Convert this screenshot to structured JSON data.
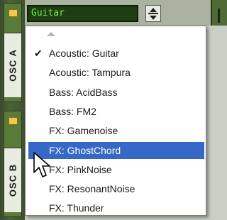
{
  "osc_panel": {
    "label_a": "OSC A",
    "label_b": "OSC B"
  },
  "patch_selector": {
    "current_value": "Guitar"
  },
  "dropdown": {
    "items": [
      {
        "label": "Acoustic: Guitar",
        "checked": true,
        "selected": false
      },
      {
        "label": "Acoustic: Tampura",
        "checked": false,
        "selected": false
      },
      {
        "label": "Bass: AcidBass",
        "checked": false,
        "selected": false
      },
      {
        "label": "Bass: FM2",
        "checked": false,
        "selected": false
      },
      {
        "label": "FX: Gamenoise",
        "checked": false,
        "selected": false
      },
      {
        "label": "FX: GhostChord",
        "checked": false,
        "selected": true
      },
      {
        "label": "FX: PinkNoise",
        "checked": false,
        "selected": false
      },
      {
        "label": "FX: ResonantNoise",
        "checked": false,
        "selected": false
      },
      {
        "label": "FX: Thunder",
        "checked": false,
        "selected": false
      }
    ],
    "check_glyph": "✔"
  },
  "colors": {
    "highlight": "#3568c7",
    "lcd_text": "#6ef04a",
    "lcd_bg": "#1f3d12",
    "led": "#f2c94c"
  }
}
